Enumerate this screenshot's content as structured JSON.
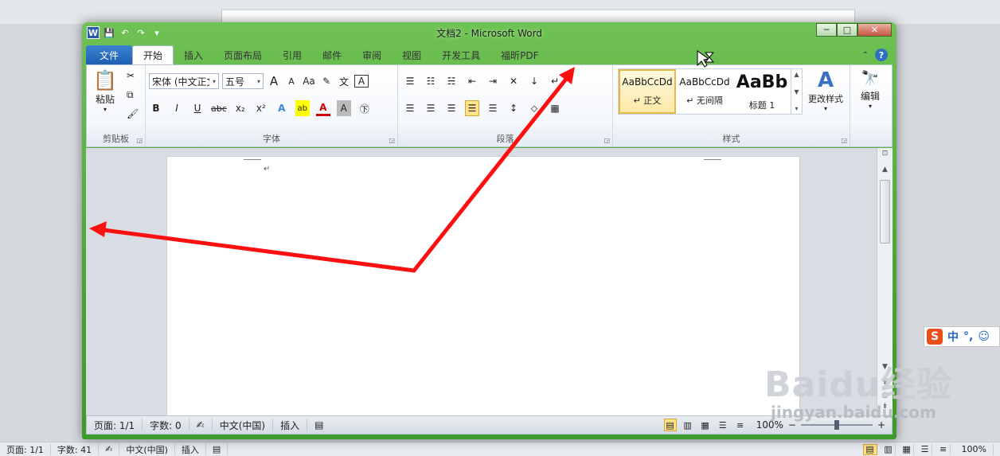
{
  "window": {
    "title": "文档2 - Microsoft Word",
    "controls": {
      "minimize": "─",
      "maximize": "□",
      "close": "✕"
    }
  },
  "tabs": [
    "文件",
    "开始",
    "插入",
    "页面布局",
    "引用",
    "邮件",
    "审阅",
    "视图",
    "开发工具",
    "福昕PDF"
  ],
  "ribbon": {
    "clipboard": {
      "paste": "粘贴",
      "label": "剪贴板"
    },
    "font": {
      "name": "宋体 (中文正文",
      "size": "五号",
      "bold": "B",
      "italic": "I",
      "underline": "U",
      "strike": "abc",
      "sub": "x₂",
      "sup": "x²",
      "case": "Aa",
      "grow": "A",
      "shrink": "A",
      "label": "字体"
    },
    "paragraph": {
      "label": "段落"
    },
    "styles": {
      "items": [
        {
          "sample": "AaBbCcDd",
          "name": "↵ 正文"
        },
        {
          "sample": "AaBbCcDd",
          "name": "↵ 无间隔"
        },
        {
          "sample": "AaBb",
          "name": "标题 1"
        }
      ],
      "change": "更改样式",
      "label": "样式"
    },
    "editing": {
      "label": "编辑"
    }
  },
  "document": {
    "paragraph_mark": "↵"
  },
  "status": {
    "page": "页面: 1/1",
    "words": "字数: 0",
    "language": "中文(中国)",
    "mode": "插入",
    "zoom": "100%"
  },
  "background_status": {
    "page": "页面: 1/1",
    "words": "字数: 41",
    "language": "中文(中国)",
    "mode": "插入",
    "zoom": "100%"
  },
  "ime": {
    "logo": "S",
    "lang": "中",
    "punct": "°,",
    "emoji": "☺"
  },
  "watermark": {
    "brand": "Baidu经验",
    "url": "jingyan.baidu.com"
  },
  "colors": {
    "frame_green": "#4aa632",
    "file_tab": "#1d5fb3",
    "annotation": "#ff1010"
  }
}
